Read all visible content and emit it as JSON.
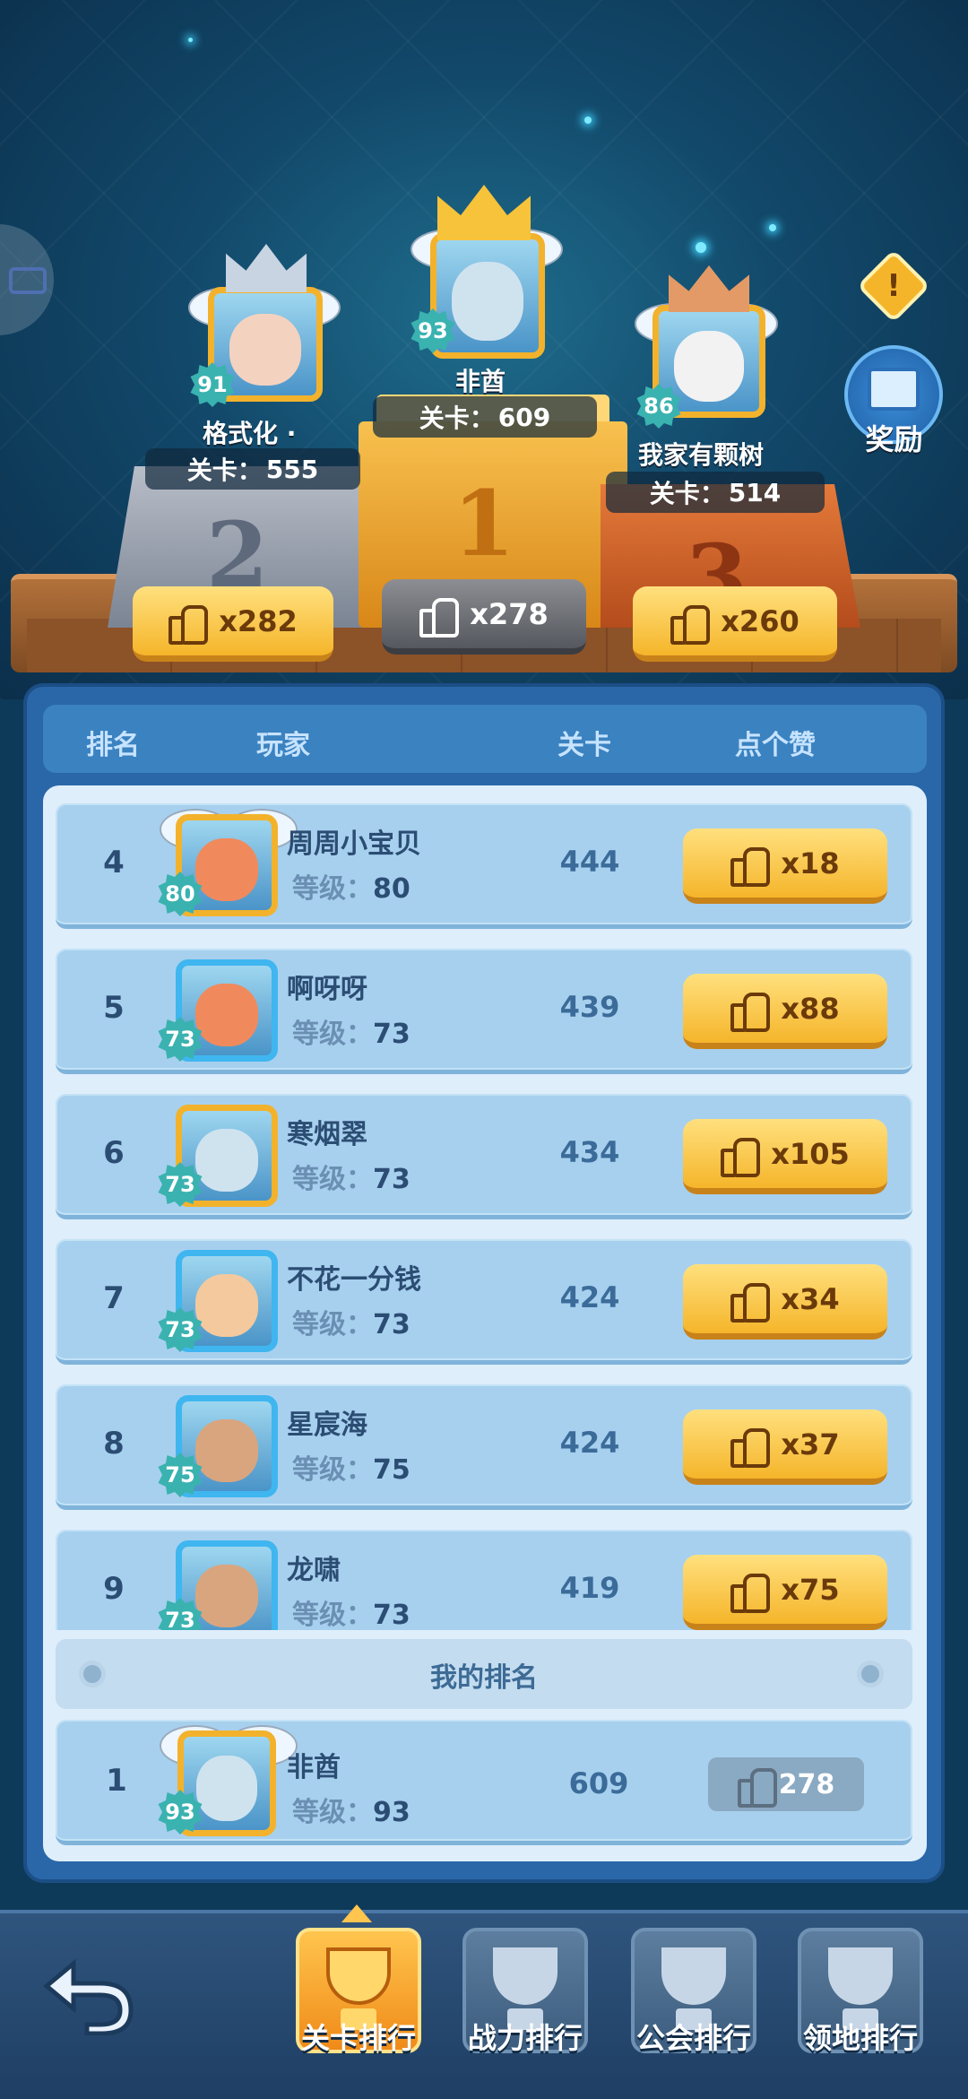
{
  "podium": {
    "second": {
      "level": "91",
      "name": "格式化 ·",
      "stage_label": "关卡：",
      "stage": "555",
      "likes": "x282",
      "place": "2"
    },
    "first": {
      "level": "93",
      "name": "非酋",
      "stage_label": "关卡：",
      "stage": "609",
      "likes": "x278",
      "place": "1"
    },
    "third": {
      "level": "86",
      "name": "我家有颗树",
      "stage_label": "关卡：",
      "stage": "514",
      "likes": "x260",
      "place": "3"
    }
  },
  "reward_label": "奖励",
  "info_icon": "!",
  "table": {
    "headers": {
      "rank": "排名",
      "player": "玩家",
      "stage": "关卡",
      "like": "点个赞"
    },
    "level_prefix": "等级：",
    "rows": [
      {
        "rank": "4",
        "name": "周周小宝贝",
        "level": "80",
        "stage": "444",
        "likes": "x18"
      },
      {
        "rank": "5",
        "name": "啊呀呀",
        "level": "73",
        "stage": "439",
        "likes": "x88"
      },
      {
        "rank": "6",
        "name": "寒烟翠",
        "level": "73",
        "stage": "434",
        "likes": "x105"
      },
      {
        "rank": "7",
        "name": "不花一分钱",
        "level": "73",
        "stage": "424",
        "likes": "x34"
      },
      {
        "rank": "8",
        "name": "星宸海",
        "level": "75",
        "stage": "424",
        "likes": "x37"
      },
      {
        "rank": "9",
        "name": "龙啸",
        "level": "73",
        "stage": "419",
        "likes": "x75"
      }
    ]
  },
  "my_rank": {
    "label": "我的排名",
    "rank": "1",
    "name": "非酋",
    "level": "93",
    "stage": "609",
    "likes": "278"
  },
  "tabs": [
    "关卡排行",
    "战力排行",
    "公会排行",
    "领地排行"
  ],
  "colors": {
    "gold": "#f5b52a",
    "panel": "#2a67a8",
    "row": "#a7d0ee"
  }
}
